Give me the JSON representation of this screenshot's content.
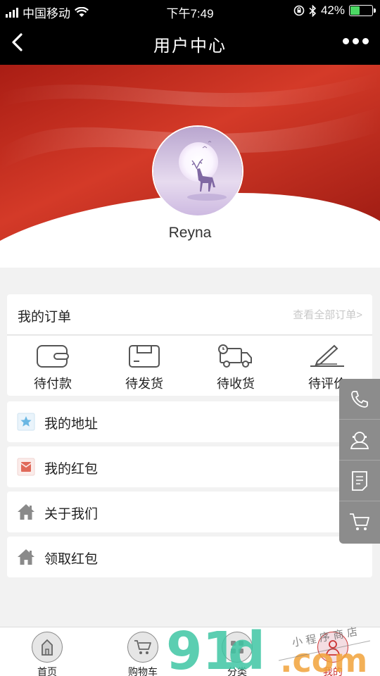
{
  "status_bar": {
    "carrier": "中国移动",
    "time": "下午7:49",
    "battery_text": "42%",
    "battery_level": 0.42,
    "icons": [
      "signal-icon",
      "wifi-icon",
      "orientation-lock-icon",
      "bluetooth-icon",
      "battery-icon"
    ]
  },
  "nav": {
    "title": "用户中心",
    "back_icon": "chevron-left-icon",
    "more_icon": "more-dots-icon"
  },
  "profile": {
    "username": "Reyna",
    "avatar": "deer-moon-avatar"
  },
  "orders": {
    "title": "我的订单",
    "view_all": "查看全部订单>",
    "items": [
      {
        "label": "待付款",
        "icon": "wallet-icon"
      },
      {
        "label": "待发货",
        "icon": "package-icon"
      },
      {
        "label": "待收货",
        "icon": "truck-icon"
      },
      {
        "label": "待评价",
        "icon": "pen-icon"
      }
    ]
  },
  "menu": [
    {
      "label": "我的地址",
      "icon": "star-icon"
    },
    {
      "label": "我的红包",
      "icon": "red-envelope-icon"
    },
    {
      "label": "关于我们",
      "icon": "house-icon"
    },
    {
      "label": "领取红包",
      "icon": "house-icon"
    }
  ],
  "side_buttons": [
    "phone-icon",
    "customer-service-icon",
    "notes-icon",
    "cart-icon"
  ],
  "tabs": [
    {
      "label": "首页",
      "icon": "home-icon",
      "active": false
    },
    {
      "label": "购物车",
      "icon": "cart-icon",
      "active": false
    },
    {
      "label": "分类",
      "icon": "grid-icon",
      "active": false
    },
    {
      "label": "我的",
      "icon": "user-icon",
      "active": true
    }
  ],
  "colors": {
    "header_red": "#c5281e",
    "active_tab": "#cc3333",
    "side_bar": "#8c8c8c"
  }
}
